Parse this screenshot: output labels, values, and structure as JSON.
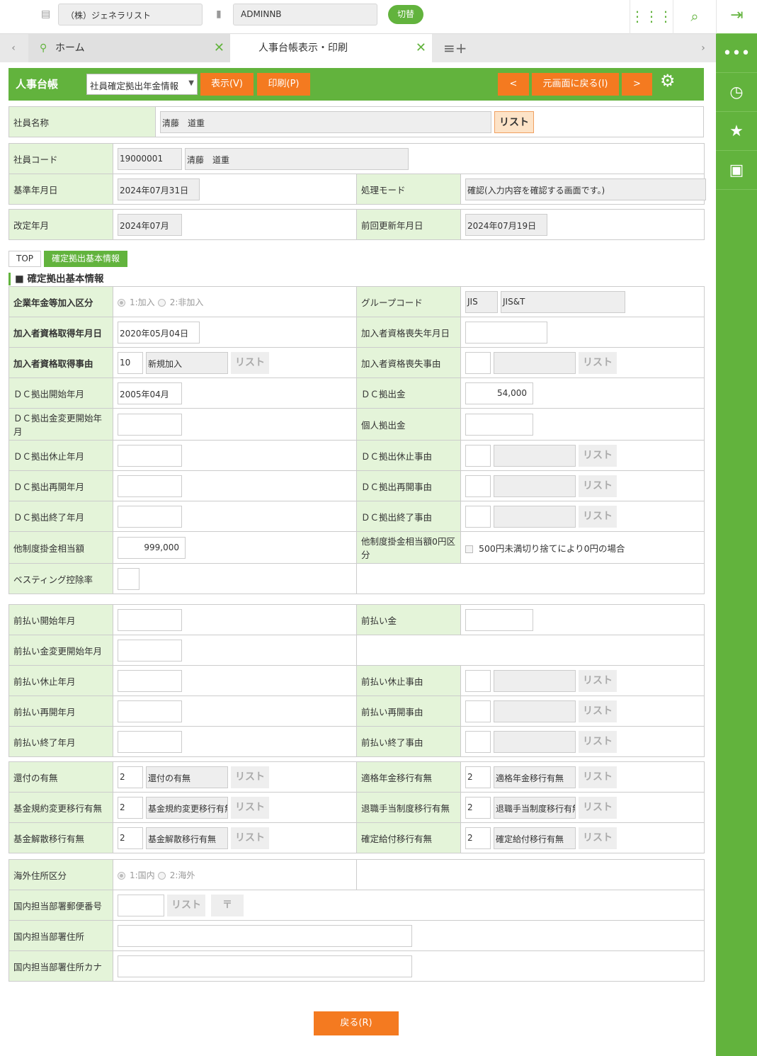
{
  "topbar": {
    "company": "（株）ジェネラリスト",
    "user": "ADMINNB",
    "switch_label": "切替"
  },
  "tabs": [
    {
      "label": "ホーム"
    },
    {
      "label": "人事台帳表示・印刷"
    }
  ],
  "header": {
    "title": "人事台帳",
    "select_value": "社員確定拠出年金情報",
    "show": "表示(V)",
    "print": "印刷(P)",
    "prev": "<",
    "back_orig": "元画面に戻る(I)",
    "next": ">"
  },
  "list_label": "リスト",
  "employee_name": {
    "label": "社員名称",
    "value": "清藤　道重"
  },
  "info_rows": [
    [
      {
        "label": "社員コード",
        "span": true,
        "items": [
          {
            "t": "ro",
            "k": "code8",
            "v": "19000001"
          },
          {
            "t": "ro",
            "k": "name",
            "v": "清藤　道重"
          }
        ]
      }
    ],
    [
      {
        "label": "基準年月日",
        "items": [
          {
            "t": "ro",
            "k": "date",
            "v": "2024年07月31日"
          }
        ]
      },
      {
        "label": "処理モード",
        "items": [
          {
            "t": "ro",
            "k": "mode",
            "v": "確認(入力内容を確認する画面です。)"
          }
        ]
      }
    ]
  ],
  "rev_rows": [
    [
      {
        "label": "改定年月",
        "items": [
          {
            "t": "ro",
            "k": "month",
            "v": "2024年07月"
          }
        ]
      },
      {
        "label": "前回更新年月日",
        "items": [
          {
            "t": "ro",
            "k": "date",
            "v": "2024年07月19日"
          }
        ]
      }
    ]
  ],
  "subtabs": [
    {
      "label": "TOP"
    },
    {
      "label": "確定拠出基本情報"
    }
  ],
  "section_title": "確定拠出基本情報",
  "dc_rows": [
    [
      {
        "label": "企業年金等加入区分",
        "bold": true,
        "items": [
          {
            "t": "radio",
            "opts": [
              "1:加入",
              "2:非加入"
            ],
            "sel": 0
          }
        ]
      },
      {
        "label": "グループコード",
        "items": [
          {
            "t": "ro",
            "k": "grp",
            "v": "JIS"
          },
          {
            "t": "ro",
            "k": "grp2",
            "v": "JIS&T"
          }
        ]
      }
    ],
    [
      {
        "label": "加入者資格取得年月日",
        "bold": true,
        "items": [
          {
            "t": "in",
            "k": "date",
            "v": "2020年05月04日"
          }
        ]
      },
      {
        "label": "加入者資格喪失年月日",
        "items": [
          {
            "t": "in",
            "k": "date",
            "v": ""
          }
        ]
      }
    ],
    [
      {
        "label": "加入者資格取得事由",
        "bold": true,
        "items": [
          {
            "t": "in",
            "k": "code",
            "v": "10"
          },
          {
            "t": "ro",
            "k": "desc",
            "v": "新規加入"
          },
          {
            "t": "btn"
          }
        ]
      },
      {
        "label": "加入者資格喪失事由",
        "items": [
          {
            "t": "in",
            "k": "code",
            "v": ""
          },
          {
            "t": "ro",
            "k": "desc",
            "v": ""
          },
          {
            "t": "btn"
          }
        ]
      }
    ],
    [
      {
        "label": "ＤＣ拠出開始年月",
        "items": [
          {
            "t": "in",
            "k": "month",
            "v": "2005年04月"
          }
        ]
      },
      {
        "label": "ＤＣ拠出金",
        "items": [
          {
            "t": "in",
            "k": "amount",
            "v": "54,000"
          }
        ]
      }
    ],
    [
      {
        "label": "ＤＣ拠出金変更開始年月",
        "items": [
          {
            "t": "in",
            "k": "month",
            "v": ""
          }
        ]
      },
      {
        "label": "個人拠出金",
        "items": [
          {
            "t": "in",
            "k": "amount",
            "v": ""
          }
        ]
      }
    ],
    [
      {
        "label": "ＤＣ拠出休止年月",
        "items": [
          {
            "t": "in",
            "k": "month",
            "v": ""
          }
        ]
      },
      {
        "label": "ＤＣ拠出休止事由",
        "items": [
          {
            "t": "in",
            "k": "code",
            "v": ""
          },
          {
            "t": "ro",
            "k": "desc",
            "v": ""
          },
          {
            "t": "btn"
          }
        ]
      }
    ],
    [
      {
        "label": "ＤＣ拠出再開年月",
        "items": [
          {
            "t": "in",
            "k": "month",
            "v": ""
          }
        ]
      },
      {
        "label": "ＤＣ拠出再開事由",
        "items": [
          {
            "t": "in",
            "k": "code",
            "v": ""
          },
          {
            "t": "ro",
            "k": "desc",
            "v": ""
          },
          {
            "t": "btn"
          }
        ]
      }
    ],
    [
      {
        "label": "ＤＣ拠出終了年月",
        "items": [
          {
            "t": "in",
            "k": "month",
            "v": ""
          }
        ]
      },
      {
        "label": "ＤＣ拠出終了事由",
        "items": [
          {
            "t": "in",
            "k": "code",
            "v": ""
          },
          {
            "t": "ro",
            "k": "desc",
            "v": ""
          },
          {
            "t": "btn"
          }
        ]
      }
    ],
    [
      {
        "label": "他制度掛金相当額",
        "items": [
          {
            "t": "in",
            "k": "amount",
            "v": "999,000"
          }
        ]
      },
      {
        "label": "他制度掛金相当額0円区分",
        "items": [
          {
            "t": "check",
            "v": "500円未満切り捨てにより0円の場合"
          }
        ]
      }
    ],
    [
      {
        "label": "ベスティング控除率",
        "items": [
          {
            "t": "in",
            "k": "tiny",
            "v": ""
          }
        ]
      },
      {
        "empty": true
      }
    ]
  ],
  "prepay_rows": [
    [
      {
        "label": "前払い開始年月",
        "items": [
          {
            "t": "in",
            "k": "month",
            "v": ""
          }
        ]
      },
      {
        "label": "前払い金",
        "items": [
          {
            "t": "in",
            "k": "amount",
            "v": ""
          }
        ]
      }
    ],
    [
      {
        "label": "前払い金変更開始年月",
        "items": [
          {
            "t": "in",
            "k": "month",
            "v": ""
          }
        ]
      },
      {
        "empty": true
      }
    ],
    [
      {
        "label": "前払い休止年月",
        "items": [
          {
            "t": "in",
            "k": "month",
            "v": ""
          }
        ]
      },
      {
        "label": "前払い休止事由",
        "items": [
          {
            "t": "in",
            "k": "code",
            "v": ""
          },
          {
            "t": "ro",
            "k": "desc",
            "v": ""
          },
          {
            "t": "btn"
          }
        ]
      }
    ],
    [
      {
        "label": "前払い再開年月",
        "items": [
          {
            "t": "in",
            "k": "month",
            "v": ""
          }
        ]
      },
      {
        "label": "前払い再開事由",
        "items": [
          {
            "t": "in",
            "k": "code",
            "v": ""
          },
          {
            "t": "ro",
            "k": "desc",
            "v": ""
          },
          {
            "t": "btn"
          }
        ]
      }
    ],
    [
      {
        "label": "前払い終了年月",
        "items": [
          {
            "t": "in",
            "k": "month",
            "v": ""
          }
        ]
      },
      {
        "label": "前払い終了事由",
        "items": [
          {
            "t": "in",
            "k": "code",
            "v": ""
          },
          {
            "t": "ro",
            "k": "desc",
            "v": ""
          },
          {
            "t": "btn"
          }
        ]
      }
    ]
  ],
  "transfer_rows": [
    [
      {
        "label": "還付の有無",
        "items": [
          {
            "t": "in",
            "k": "code",
            "v": "2"
          },
          {
            "t": "ro",
            "k": "desc",
            "v": "還付の有無"
          },
          {
            "t": "btn"
          }
        ]
      },
      {
        "label": "適格年金移行有無",
        "items": [
          {
            "t": "in",
            "k": "code",
            "v": "2"
          },
          {
            "t": "ro",
            "k": "desc",
            "v": "適格年金移行有無"
          },
          {
            "t": "btn"
          }
        ]
      }
    ],
    [
      {
        "label": "基金規約変更移行有無",
        "items": [
          {
            "t": "in",
            "k": "code",
            "v": "2"
          },
          {
            "t": "ro",
            "k": "desc",
            "v": "基金規約変更移行有無"
          },
          {
            "t": "btn"
          }
        ]
      },
      {
        "label": "退職手当制度移行有無",
        "items": [
          {
            "t": "in",
            "k": "code",
            "v": "2"
          },
          {
            "t": "ro",
            "k": "desc",
            "v": "退職手当制度移行有無"
          },
          {
            "t": "btn"
          }
        ]
      }
    ],
    [
      {
        "label": "基金解散移行有無",
        "items": [
          {
            "t": "in",
            "k": "code",
            "v": "2"
          },
          {
            "t": "ro",
            "k": "desc",
            "v": "基金解散移行有無"
          },
          {
            "t": "btn"
          }
        ]
      },
      {
        "label": "確定給付移行有無",
        "items": [
          {
            "t": "in",
            "k": "code",
            "v": "2"
          },
          {
            "t": "ro",
            "k": "desc",
            "v": "確定給付移行有無"
          },
          {
            "t": "btn"
          }
        ]
      }
    ]
  ],
  "address_rows": [
    [
      {
        "label": "海外住所区分",
        "items": [
          {
            "t": "radio",
            "opts": [
              "1:国内",
              "2:海外"
            ],
            "sel": 0
          }
        ]
      },
      {
        "empty": true
      }
    ],
    [
      {
        "label": "国内担当部署郵便番号",
        "span": true,
        "items": [
          {
            "t": "in",
            "k": "zip",
            "v": ""
          },
          {
            "t": "btn"
          },
          {
            "t": "btn",
            "v": "〒"
          }
        ]
      }
    ],
    [
      {
        "label": "国内担当部署住所",
        "span": true,
        "items": [
          {
            "t": "in",
            "k": "address",
            "v": ""
          }
        ]
      }
    ],
    [
      {
        "label": "国内担当部署住所カナ",
        "span": true,
        "items": [
          {
            "t": "in",
            "k": "address",
            "v": ""
          }
        ]
      }
    ]
  ],
  "footer": {
    "back": "戻る(R)"
  }
}
